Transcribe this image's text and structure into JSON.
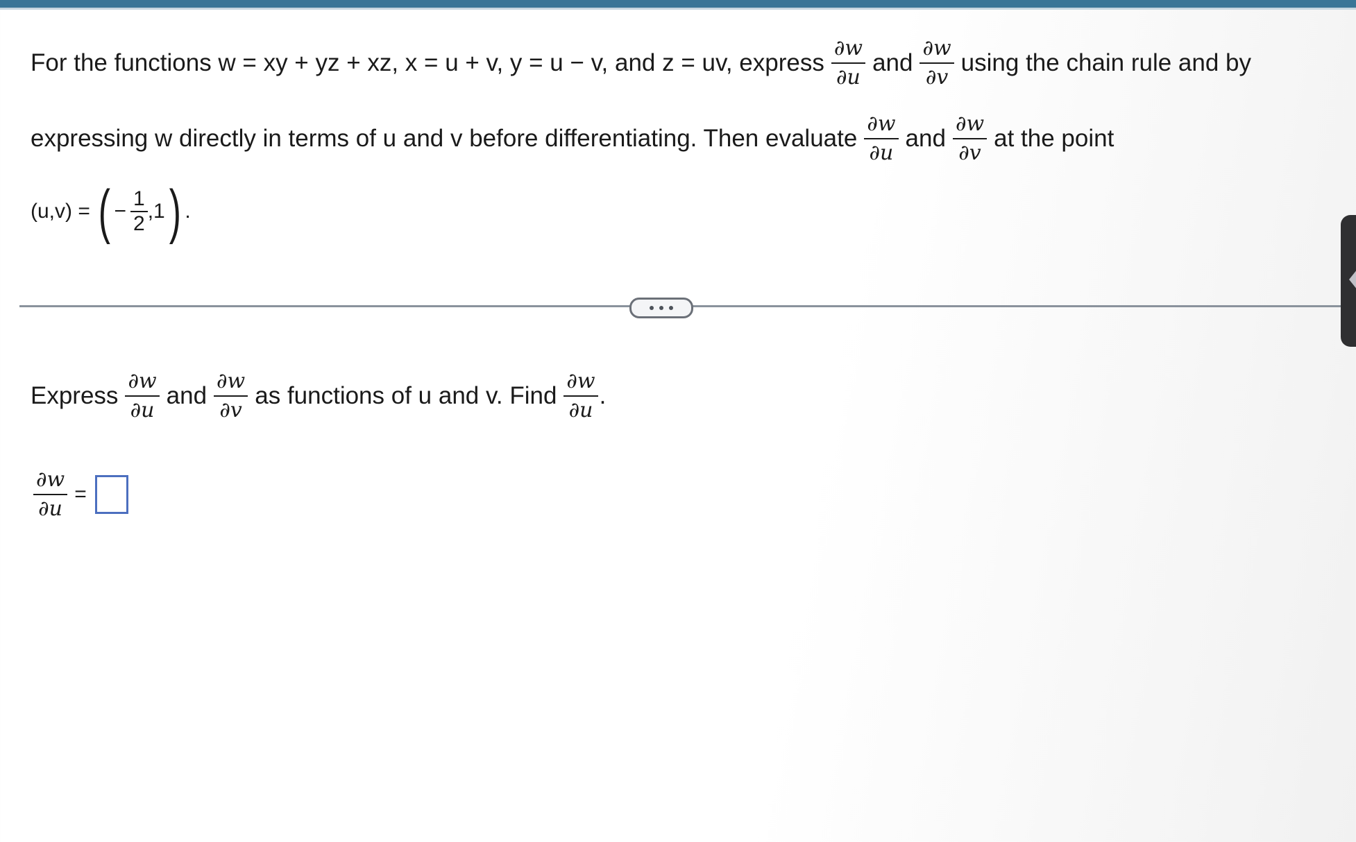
{
  "colors": {
    "header_bar": "#3a7597",
    "answer_box_border": "#4c6fbf",
    "divider": "#8a929c"
  },
  "question": {
    "line1": {
      "prefix": "For the functions w = xy + yz + xz, x = u + v, y = u − v, and z = uv, express",
      "frac1": {
        "num": "∂w",
        "den": "∂u"
      },
      "mid": "and",
      "frac2": {
        "num": "∂w",
        "den": "∂v"
      },
      "suffix": "using the chain rule and by"
    },
    "line2": {
      "prefix": "expressing w directly in terms of u and v before differentiating. Then evaluate",
      "frac1": {
        "num": "∂w",
        "den": "∂u"
      },
      "mid": "and",
      "frac2": {
        "num": "∂w",
        "den": "∂v"
      },
      "suffix": "at the point"
    },
    "line3": {
      "prefix": "(u,v) =",
      "minus": "−",
      "frac": {
        "num": "1",
        "den": "2"
      },
      "comma_val": ",1",
      "period": "."
    }
  },
  "more_button": {
    "icon": "ellipsis-icon"
  },
  "side_tab": {
    "icon": "chevron-left-icon"
  },
  "part": {
    "prefix": "Express",
    "frac1": {
      "num": "∂w",
      "den": "∂u"
    },
    "mid": "and",
    "frac2": {
      "num": "∂w",
      "den": "∂v"
    },
    "text": "as functions of u and v. Find",
    "frac3": {
      "num": "∂w",
      "den": "∂u"
    },
    "period": "."
  },
  "answer": {
    "frac": {
      "num": "∂w",
      "den": "∂u"
    },
    "equals": "=",
    "value": ""
  }
}
